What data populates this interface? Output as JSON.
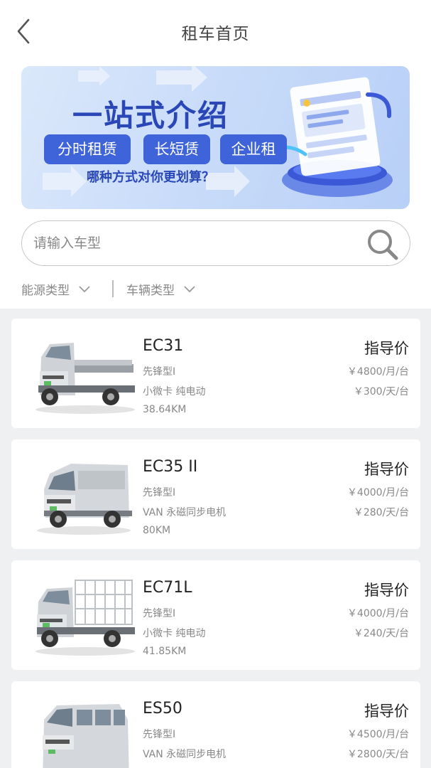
{
  "header": {
    "title": "租车首页"
  },
  "banner": {
    "title": "一站式介绍",
    "tags": [
      "分时租赁",
      "长短赁",
      "企业租"
    ],
    "subtitle": "哪种方式对你更划算？"
  },
  "search": {
    "placeholder": "请输入车型",
    "value": ""
  },
  "filters": [
    {
      "label": "能源类型"
    },
    {
      "label": "车辆类型"
    }
  ],
  "vehicles": [
    {
      "name": "EC31",
      "version": "先锋型I",
      "type": "小微卡 纯电动",
      "range": "38.64KM",
      "price_label": "指导价",
      "monthly": "￥4800/月/台",
      "daily": "￥300/天/台",
      "body": "flatbed"
    },
    {
      "name": "EC35 II",
      "version": "先锋型I",
      "type": "VAN 永磁同步电机",
      "range": "80KM",
      "price_label": "指导价",
      "monthly": "￥4000/月/台",
      "daily": "￥280/天/台",
      "body": "van"
    },
    {
      "name": "EC71L",
      "version": "先锋型I",
      "type": "小微卡 纯电动",
      "range": "41.85KM",
      "price_label": "指导价",
      "monthly": "￥4000/月/台",
      "daily": "￥240/天/台",
      "body": "stake"
    },
    {
      "name": "ES50",
      "version": "先锋型I",
      "type": "VAN 永磁同步电机",
      "range": "",
      "price_label": "指导价",
      "monthly": "￥4500/月/台",
      "daily": "￥2800/天/台",
      "body": "minibus"
    }
  ]
}
